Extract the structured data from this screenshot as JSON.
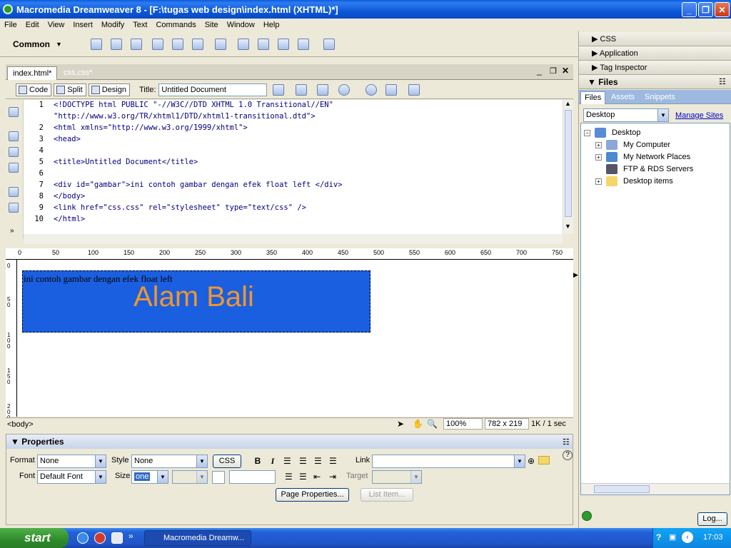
{
  "window": {
    "title": "Macromedia Dreamweaver 8 - [F:\\tugas web design\\index.html (XHTML)*]",
    "min": "_",
    "max": "❐",
    "close": "✕"
  },
  "menu": [
    "File",
    "Edit",
    "View",
    "Insert",
    "Modify",
    "Text",
    "Commands",
    "Site",
    "Window",
    "Help"
  ],
  "insertbar": {
    "category": "Common"
  },
  "doc": {
    "tabs": [
      {
        "label": "index.html*"
      },
      {
        "label": "css.css*"
      }
    ],
    "views": {
      "code": "Code",
      "split": "Split",
      "design": "Design"
    },
    "title_label": "Title:",
    "title_value": "Untitled Document"
  },
  "code_lines": [
    {
      "n": "1",
      "text": "<!DOCTYPE html PUBLIC \"-//W3C//DTD XHTML 1.0 Transitional//EN\""
    },
    {
      "n": "",
      "text": "\"http://www.w3.org/TR/xhtml1/DTD/xhtml1-transitional.dtd\">"
    },
    {
      "n": "2",
      "text": "<html xmlns=\"http://www.w3.org/1999/xhtml\">"
    },
    {
      "n": "3",
      "text": "<head>"
    },
    {
      "n": "4",
      "text": ""
    },
    {
      "n": "5",
      "text": "<title>Untitled Document</title>"
    },
    {
      "n": "6",
      "text": ""
    },
    {
      "n": "7",
      "text": "<div id=\"gambar\">ini contoh gambar dengan efek float left </div>"
    },
    {
      "n": "8",
      "text": "</body>"
    },
    {
      "n": "9",
      "text": "<link href=\"css.css\" rel=\"stylesheet\" type=\"text/css\" />"
    },
    {
      "n": "10",
      "text": "</html>"
    }
  ],
  "ruler_labels": [
    "0",
    "50",
    "100",
    "150",
    "200",
    "250",
    "300",
    "350",
    "400",
    "450",
    "500",
    "550",
    "600",
    "650",
    "700",
    "750"
  ],
  "vruler_labels": [
    "0",
    "50",
    "100",
    "150",
    "200"
  ],
  "design": {
    "div_text": "ini contoh gambar dengan efek float left",
    "image_text": "Alam Bali",
    "div_color": "#1a5fe0",
    "image_text_color": "#f0962e"
  },
  "status": {
    "tag": "<body>",
    "zoom": "100%",
    "size": "782 x 219",
    "download": "1K / 1 sec"
  },
  "properties": {
    "title": "Properties",
    "format_label": "Format",
    "format_value": "None",
    "style_label": "Style",
    "style_value": "None",
    "css_btn": "CSS",
    "bold": "B",
    "italic": "I",
    "link_label": "Link",
    "link_value": "",
    "font_label": "Font",
    "font_value": "Default Font",
    "size_label": "Size",
    "size_value": "one",
    "target_label": "Target",
    "page_props_btn": "Page Properties...",
    "list_item_btn": "List Item..."
  },
  "panels": {
    "css": "CSS",
    "application": "Application",
    "tag_inspector": "Tag Inspector",
    "files": "Files",
    "file_tabs": [
      "Files",
      "Assets",
      "Snippets"
    ],
    "site_select": "Desktop",
    "manage_sites": "Manage Sites",
    "tree": [
      "Desktop",
      "My Computer",
      "My Network Places",
      "FTP & RDS Servers",
      "Desktop items"
    ],
    "log_btn": "Log..."
  },
  "taskbar": {
    "start": "start",
    "task": "Macromedia Dreamw...",
    "time": "17:03"
  }
}
